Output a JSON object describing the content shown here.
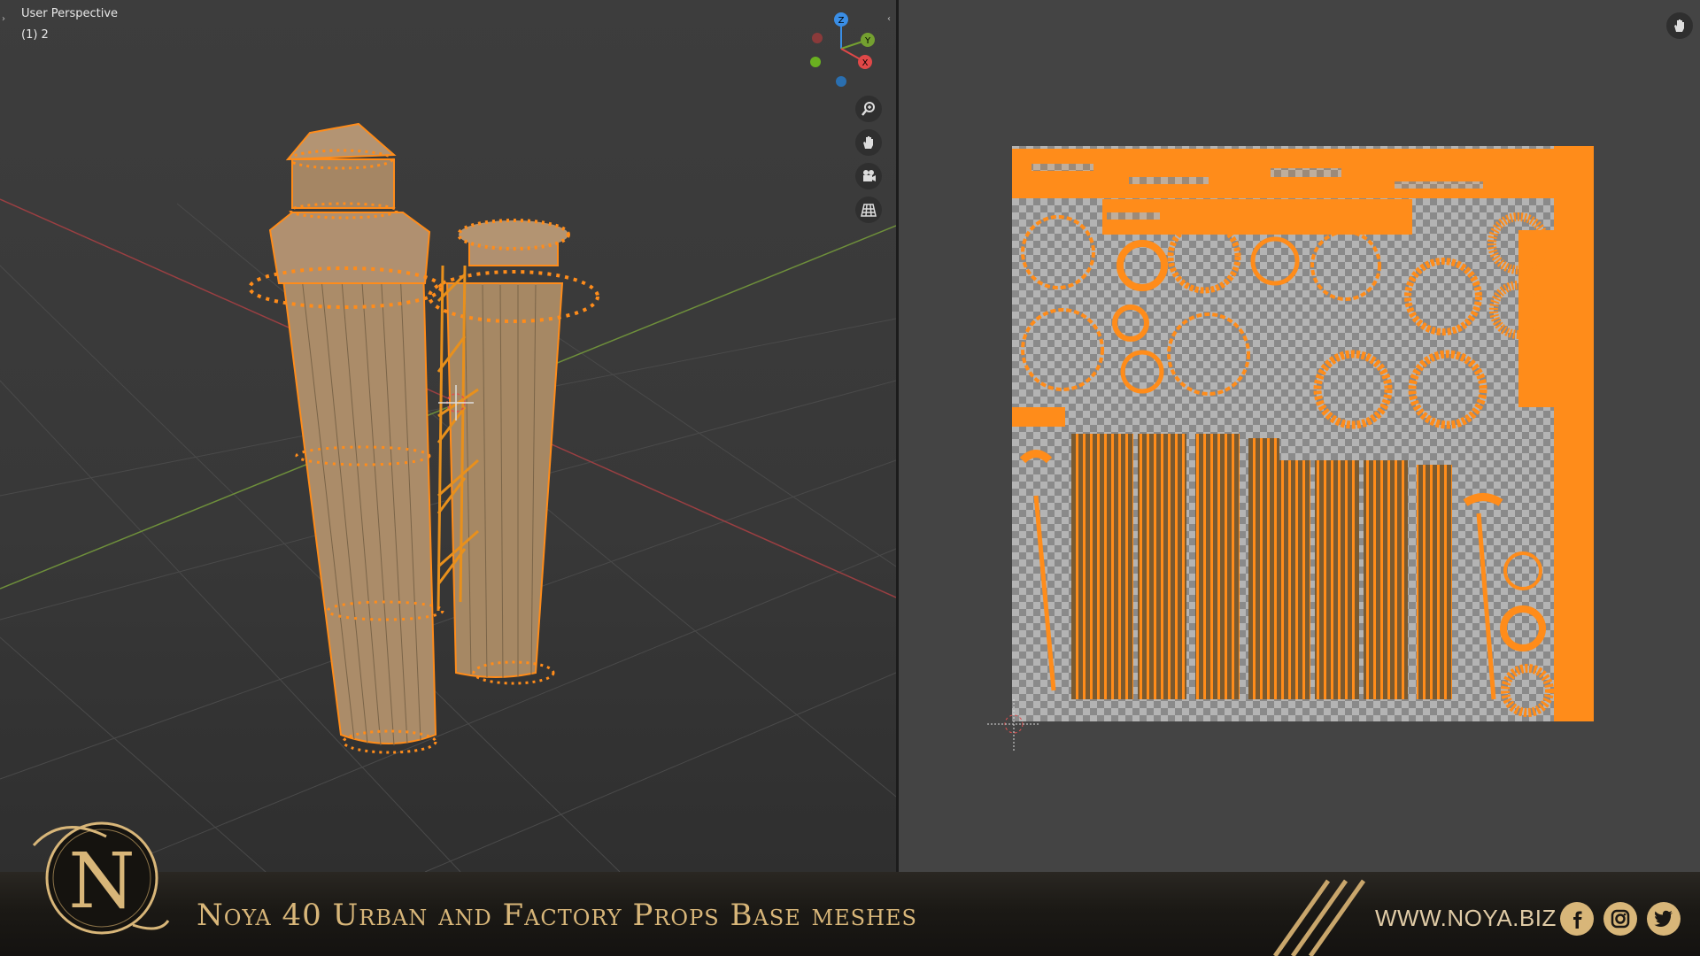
{
  "viewport3d": {
    "title": "User Perspective",
    "subtitle": "(1) 2",
    "gizmo": {
      "z": "Z",
      "y": "Y",
      "x": "X"
    },
    "tools": [
      "zoom-icon",
      "hand-pan-icon",
      "camera-icon",
      "grid-icon"
    ]
  },
  "uv_editor": {
    "tools": [
      "hand-pan-icon"
    ]
  },
  "banner": {
    "title": "Noya 40 Urban and Factory Props Base meshes",
    "url": "WWW.NOYA.BIZ",
    "social": [
      "facebook-icon",
      "instagram-icon",
      "twitter-icon"
    ]
  },
  "colors": {
    "accent_orange": "#ff8c1a",
    "mesh_tan": "#a88a68",
    "gold": "#d8b679",
    "axis_red": "#e04848",
    "axis_green": "#74a030",
    "axis_blue": "#3a8ee6"
  }
}
